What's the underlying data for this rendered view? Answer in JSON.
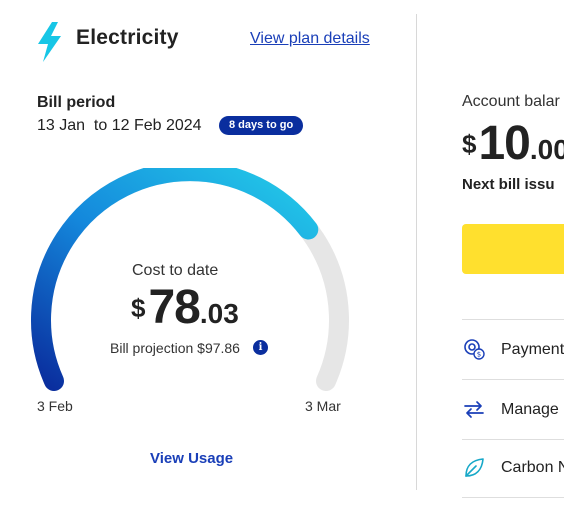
{
  "card": {
    "title": "Electricity",
    "plan_link": "View plan details",
    "bill_period_label": "Bill period",
    "bill_period_dates": "13 Jan  to 12 Feb 2024",
    "days_badge": "8 days to go"
  },
  "gauge": {
    "progress": 0.73,
    "cost_label": "Cost to date",
    "currency": "$",
    "cost_whole": "78",
    "cost_cents": ".03",
    "projection": "Bill projection $97.86",
    "info_icon": "i",
    "start_label": "3 Feb",
    "end_label": "3 Mar"
  },
  "usage_link": "View Usage",
  "account": {
    "balance_label": "Account balar",
    "currency": "$",
    "balance_whole": "10",
    "balance_cents": ".00",
    "next_bill_label": "Next bill issu",
    "rows": [
      {
        "icon": "payment-gear-icon",
        "label": "Payment"
      },
      {
        "icon": "manage-arrows-icon",
        "label": "Manage"
      },
      {
        "icon": "leaf-icon",
        "label": "Carbon N"
      }
    ]
  },
  "colors": {
    "accent": "#1a3fb8",
    "badge": "#0a2e9e",
    "gauge_start": "#0a2e9e",
    "gauge_end": "#26d4ea",
    "gauge_track": "#e6e6e6",
    "bolt": "#17c6e6",
    "cta": "#ffe02e"
  }
}
